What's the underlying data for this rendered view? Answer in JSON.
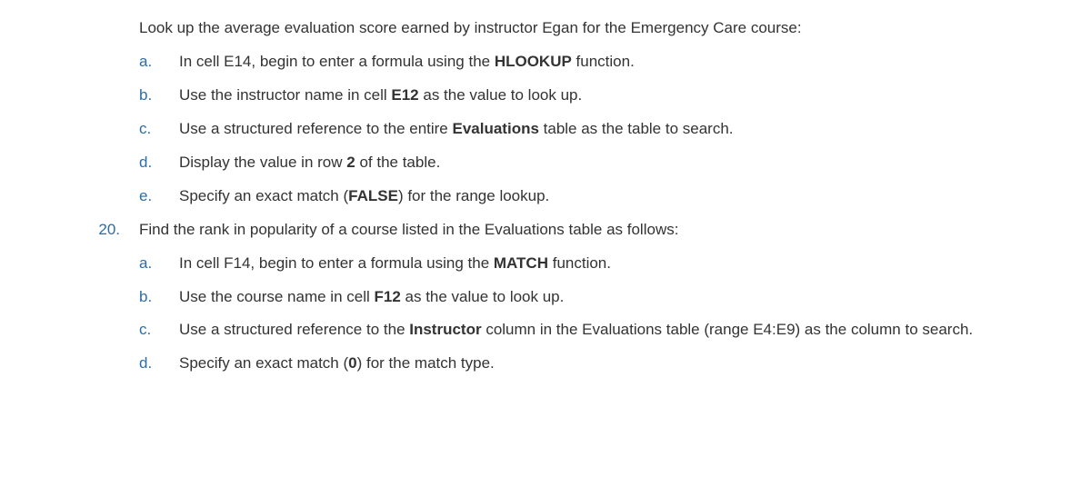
{
  "intro": {
    "text_a": "Look up the average evaluation score earned by instructor Egan for the Emergency Care course:"
  },
  "q1": {
    "sub": {
      "a": {
        "letter": "a.",
        "pre": "In cell E14, begin to enter a formula using the ",
        "bold1": "HLOOKUP",
        "post": " function."
      },
      "b": {
        "letter": "b.",
        "pre": "Use the instructor name in cell ",
        "bold1": "E12",
        "post": " as the value to look up."
      },
      "c": {
        "letter": "c.",
        "pre": "Use a structured reference to the entire ",
        "bold1": "Evaluations",
        "post": " table as the table to search."
      },
      "d": {
        "letter": "d.",
        "pre": "Display the value in row ",
        "bold1": "2",
        "post": " of the table."
      },
      "e": {
        "letter": "e.",
        "pre": "Specify an exact match (",
        "bold1": "FALSE",
        "post": ") for the range lookup."
      }
    }
  },
  "q2": {
    "number": "20.",
    "body": "Find the rank in popularity of a course listed in the Evaluations table as follows:",
    "sub": {
      "a": {
        "letter": "a.",
        "pre": "In cell F14, begin to enter a formula using the ",
        "bold1": "MATCH",
        "post": " function."
      },
      "b": {
        "letter": "b.",
        "pre": "Use the course name in cell ",
        "bold1": "F12",
        "post": " as the value to look up."
      },
      "c": {
        "letter": "c.",
        "pre": "Use a structured reference to the ",
        "bold1": "Instructor",
        "post": " column in the Evaluations table (range E4:E9) as the column to search."
      },
      "d": {
        "letter": "d.",
        "pre": "Specify an exact match (",
        "bold1": "0",
        "post": ") for the match type."
      }
    }
  }
}
